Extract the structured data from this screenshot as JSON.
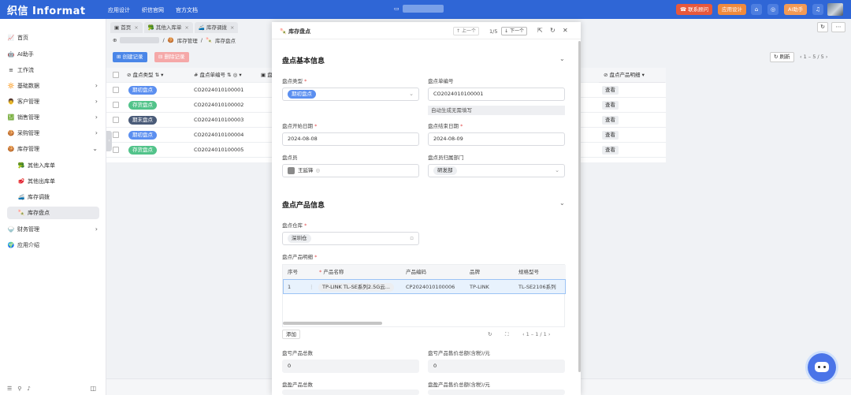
{
  "app": {
    "brand": "织信 Informat"
  },
  "topnav": [
    "应用设计",
    "织信官网",
    "官方文档"
  ],
  "topright": {
    "contact_label": "联系顾问",
    "design_label": "应用设计",
    "ai_label": "AI助手",
    "contact_color": "#e8583c",
    "design_color": "#f08a3c",
    "ai_color": "#f39a55"
  },
  "sidebar": {
    "items": [
      {
        "label": "首页",
        "icon": "📈"
      },
      {
        "label": "AI助手",
        "icon": "🤖"
      },
      {
        "label": "工作流",
        "icon": "≡"
      },
      {
        "label": "基础数据",
        "icon": "🔆",
        "arrow": "›"
      },
      {
        "label": "客户管理",
        "icon": "👨",
        "arrow": "›"
      },
      {
        "label": "销售管理",
        "icon": "💹",
        "arrow": "›"
      },
      {
        "label": "采购管理",
        "icon": "🍪",
        "arrow": "›"
      },
      {
        "label": "库存管理",
        "icon": "🍪",
        "arrow": "⌄"
      },
      {
        "label": "其他入库单",
        "icon": "🥦"
      },
      {
        "label": "其他出库单",
        "icon": "🥩"
      },
      {
        "label": "库存调拨",
        "icon": "🚄"
      },
      {
        "label": "库存盘点",
        "icon": "🍡"
      },
      {
        "label": "财务管理",
        "icon": "🍚",
        "arrow": "›"
      },
      {
        "label": "应用介绍",
        "icon": "🌍"
      }
    ]
  },
  "tabs": [
    {
      "label": "首页"
    },
    {
      "label": "其他入库单"
    },
    {
      "label": "库存调拨"
    }
  ],
  "breadcrumb": [
    "库存管理",
    "库存盘点"
  ],
  "toolbar": {
    "create_label": "创建记录",
    "delete_label": "删除记录",
    "refresh_label": "刷新",
    "pager": "1 – 5 / 5"
  },
  "table": {
    "headers": [
      "盘点类型",
      "盘点单编号",
      "盘"
    ],
    "rows": [
      {
        "type": "期初盘点",
        "type_color": "#5b8ff0",
        "code": "CO2024010100001"
      },
      {
        "type": "存货盘点",
        "type_color": "#52c38a",
        "code": "CO2024010100002"
      },
      {
        "type": "期末盘点",
        "type_color": "#4a5b78",
        "code": "CO2024010100003"
      },
      {
        "type": "期初盘点",
        "type_color": "#5b8ff0",
        "code": "CO2024010100004"
      },
      {
        "type": "存货盘点",
        "type_color": "#52c38a",
        "code": "CO2024010100005"
      }
    ],
    "right_header": "盘点产品明细",
    "view_label": "查看"
  },
  "modal": {
    "title": "库存盘点",
    "prev_label": "上一个",
    "next_label": "下一个",
    "page": "1/5",
    "section1_title": "盘点基本信息",
    "type_label": "盘点类型",
    "type_value": "期初盘点",
    "code_label": "盘点单编号",
    "code_value": "CO2024010100001",
    "code_hint": "自动生成无需填写",
    "start_label": "盘点开始日期",
    "start_value": "2024-08-08",
    "end_label": "盘点结束日期",
    "end_value": "2024-08-09",
    "staff_label": "盘点员",
    "staff_value": "王延锋",
    "dept_label": "盘点员归属部门",
    "dept_value": "研发部",
    "section2_title": "盘点产品信息",
    "warehouse_label": "盘点仓库",
    "warehouse_value": "深圳仓",
    "detail_label": "盘点产品明细",
    "detail_headers": [
      "序号",
      "产品名称",
      "产品编码",
      "品牌",
      "规格型号"
    ],
    "detail_row": {
      "no": "1",
      "name": "TP-LINK TL-SE系列2.5G云...",
      "code": "CP2024010100006",
      "brand": "TP-LINK",
      "spec": "TL-SE2106系列"
    },
    "add_label": "添加",
    "detail_pager": "1 – 1 / 1",
    "profit_count_label": "盘亏产品总数",
    "profit_count_value": "0",
    "profit_amount_label": "盘亏产品售价总额(含税)/元",
    "profit_amount_value": "0",
    "surplus_count_label": "盘盈产品总数",
    "surplus_amount_label": "盘盈产品售价总额(含税)/元"
  }
}
